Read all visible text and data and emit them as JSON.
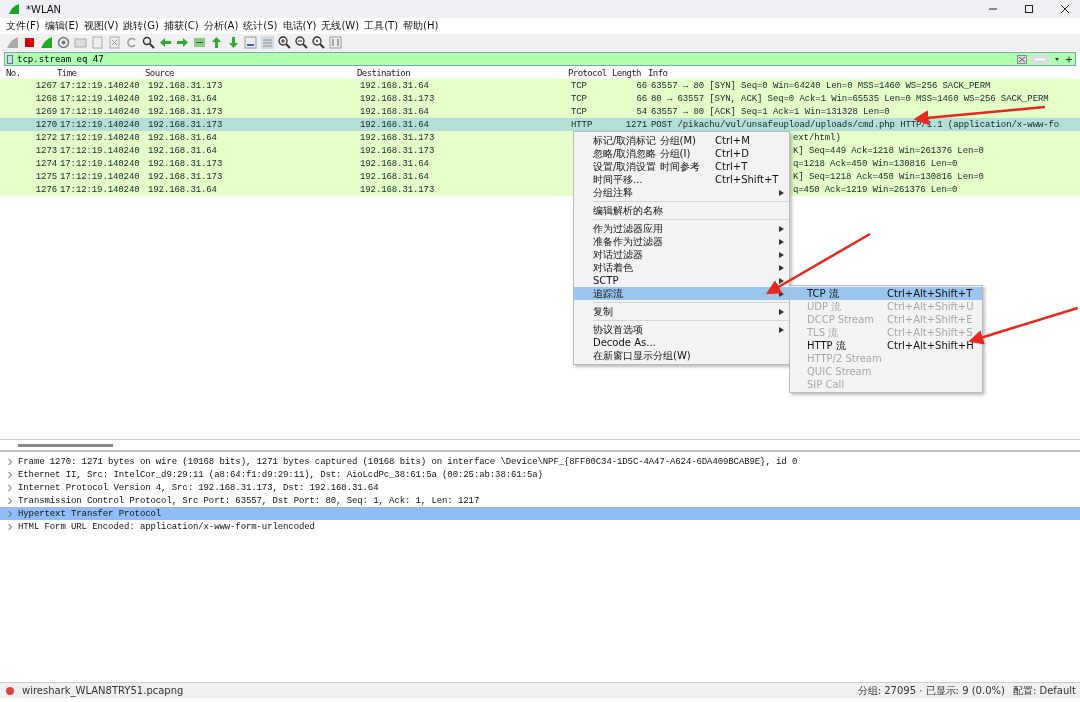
{
  "window": {
    "title": "*WLAN"
  },
  "menu_bar": [
    "文件(F)",
    "编辑(E)",
    "视图(V)",
    "跳转(G)",
    "捕获(C)",
    "分析(A)",
    "统计(S)",
    "电话(Y)",
    "无线(W)",
    "工具(T)",
    "帮助(H)"
  ],
  "filter": {
    "value": "tcp.stream eq 47"
  },
  "packet_list": {
    "columns": [
      "No.",
      "Time",
      "Source",
      "Destination",
      "Protocol",
      "Length",
      "Info"
    ],
    "rows": [
      {
        "no": "1267",
        "time": "17:12:19.140240",
        "source": "192.168.31.173",
        "destination": "192.168.31.64",
        "protocol": "TCP",
        "length": "66",
        "info": "63557 → 80 [SYN] Seq=0 Win=64240 Len=0 MSS=1460 WS=256 SACK_PERM",
        "selected": false,
        "covered": false
      },
      {
        "no": "1268",
        "time": "17:12:19.140240",
        "source": "192.168.31.64",
        "destination": "192.168.31.173",
        "protocol": "TCP",
        "length": "66",
        "info": "80 → 63557 [SYN, ACK] Seq=0 Ack=1 Win=65535 Len=0 MSS=1460 WS=256 SACK_PERM",
        "selected": false,
        "covered": false
      },
      {
        "no": "1269",
        "time": "17:12:19.140240",
        "source": "192.168.31.173",
        "destination": "192.168.31.64",
        "protocol": "TCP",
        "length": "54",
        "info": "63557 → 80 [ACK] Seq=1 Ack=1 Win=131328 Len=0",
        "selected": false,
        "covered": false
      },
      {
        "no": "1270",
        "time": "17:12:19.140240",
        "source": "192.168.31.173",
        "destination": "192.168.31.64",
        "protocol": "HTTP",
        "length": "1271",
        "info": "POST /pikachu/vul/unsafeupload/uploads/cmd.php HTTP/1.1  (application/x-www-fo",
        "selected": true,
        "covered": false
      },
      {
        "no": "1272",
        "time": "17:12:19.140240",
        "source": "192.168.31.64",
        "destination": "192.168.31.173",
        "info": "ext/html)",
        "selected": false,
        "covered": true
      },
      {
        "no": "1273",
        "time": "17:12:19.140240",
        "source": "192.168.31.64",
        "destination": "192.168.31.173",
        "info": "K] Seq=449 Ack=1218 Win=261376 Len=0",
        "selected": false,
        "covered": true
      },
      {
        "no": "1274",
        "time": "17:12:19.140240",
        "source": "192.168.31.173",
        "destination": "192.168.31.64",
        "info": "q=1218 Ack=450 Win=130816 Len=0",
        "selected": false,
        "covered": true
      },
      {
        "no": "1275",
        "time": "17:12:19.140240",
        "source": "192.168.31.173",
        "destination": "192.168.31.64",
        "info": "K] Seq=1218 Ack=450 Win=130816 Len=0",
        "selected": false,
        "covered": true
      },
      {
        "no": "1276",
        "time": "17:12:19.140240",
        "source": "192.168.31.64",
        "destination": "192.168.31.173",
        "info": "q=450 Ack=1219 Win=261376 Len=0",
        "selected": false,
        "covered": true
      }
    ]
  },
  "context_menu": {
    "items": [
      {
        "kind": "item",
        "label": "标记/取消标记 分组(M)",
        "shortcut": "Ctrl+M",
        "submenu": false,
        "selected": false
      },
      {
        "kind": "item",
        "label": "忽略/取消忽略 分组(I)",
        "shortcut": "Ctrl+D",
        "submenu": false,
        "selected": false
      },
      {
        "kind": "item",
        "label": "设置/取消设置 时间参考",
        "shortcut": "Ctrl+T",
        "submenu": false,
        "selected": false
      },
      {
        "kind": "item",
        "label": "时间平移...",
        "shortcut": "Ctrl+Shift+T",
        "submenu": false,
        "selected": false
      },
      {
        "kind": "item",
        "label": "分组注释",
        "submenu": true,
        "selected": false
      },
      {
        "kind": "separator"
      },
      {
        "kind": "item",
        "label": "编辑解析的名称",
        "submenu": false,
        "selected": false
      },
      {
        "kind": "separator"
      },
      {
        "kind": "item",
        "label": "作为过滤器应用",
        "submenu": true,
        "selected": false
      },
      {
        "kind": "item",
        "label": "准备作为过滤器",
        "submenu": true,
        "selected": false
      },
      {
        "kind": "item",
        "label": "对话过滤器",
        "submenu": true,
        "selected": false
      },
      {
        "kind": "item",
        "label": "对话着色",
        "submenu": true,
        "selected": false
      },
      {
        "kind": "item",
        "label": "SCTP",
        "submenu": true,
        "selected": false
      },
      {
        "kind": "item",
        "label": "追踪流",
        "submenu": true,
        "selected": true
      },
      {
        "kind": "separator"
      },
      {
        "kind": "item",
        "label": "复制",
        "submenu": true,
        "selected": false
      },
      {
        "kind": "separator"
      },
      {
        "kind": "item",
        "label": "协议首选项",
        "submenu": true,
        "selected": false
      },
      {
        "kind": "item",
        "label": "Decode As...",
        "submenu": false,
        "selected": false
      },
      {
        "kind": "item",
        "label": "在新窗口显示分组(W)",
        "submenu": false,
        "selected": false
      }
    ]
  },
  "submenu": {
    "items": [
      {
        "label": "TCP 流",
        "shortcut": "Ctrl+Alt+Shift+T",
        "selected": true,
        "disabled": false
      },
      {
        "label": "UDP 流",
        "shortcut": "Ctrl+Alt+Shift+U",
        "selected": false,
        "disabled": true
      },
      {
        "label": "DCCP Stream",
        "shortcut": "Ctrl+Alt+Shift+E",
        "selected": false,
        "disabled": true
      },
      {
        "label": "TLS 流",
        "shortcut": "Ctrl+Alt+Shift+S",
        "selected": false,
        "disabled": true
      },
      {
        "label": "HTTP 流",
        "shortcut": "Ctrl+Alt+Shift+H",
        "selected": false,
        "disabled": false
      },
      {
        "label": "HTTP/2 Stream",
        "selected": false,
        "disabled": true
      },
      {
        "label": "QUIC Stream",
        "selected": false,
        "disabled": true
      },
      {
        "label": "SIP Call",
        "selected": false,
        "disabled": true
      }
    ]
  },
  "packet_details": [
    {
      "label": "Frame 1270: 1271 bytes on wire (10168 bits), 1271 bytes captured (10168 bits) on interface \\Device\\NPF_{8FF00C34-1D5C-4A47-A624-6DA409BCAB9E}, id 0",
      "expanded": false,
      "selected": false
    },
    {
      "label": "Ethernet II, Src: IntelCor_d9:29:11 (a8:64:f1:d9:29:11), Dst: AioLcdPc_38:61:5a (00:25:ab:38:61:5a)",
      "expanded": false,
      "selected": false
    },
    {
      "label": "Internet Protocol Version 4, Src: 192.168.31.173, Dst: 192.168.31.64",
      "expanded": false,
      "selected": false
    },
    {
      "label": "Transmission Control Protocol, Src Port: 63557, Dst Port: 80, Seq: 1, Ack: 1, Len: 1217",
      "expanded": false,
      "selected": false
    },
    {
      "label": "Hypertext Transfer Protocol",
      "expanded": false,
      "selected": true
    },
    {
      "label": "HTML Form URL Encoded: application/x-www-form-urlencoded",
      "expanded": false,
      "selected": false
    }
  ],
  "status_bar": {
    "file": "wireshark_WLAN8TRY51.pcapng",
    "packets": "分组: 27095 · 已显示: 9 (0.0%)",
    "profile": "配置: Default"
  },
  "annotations": [
    {
      "kind": "arrow"
    },
    {
      "kind": "arrow"
    },
    {
      "kind": "arrow"
    }
  ]
}
